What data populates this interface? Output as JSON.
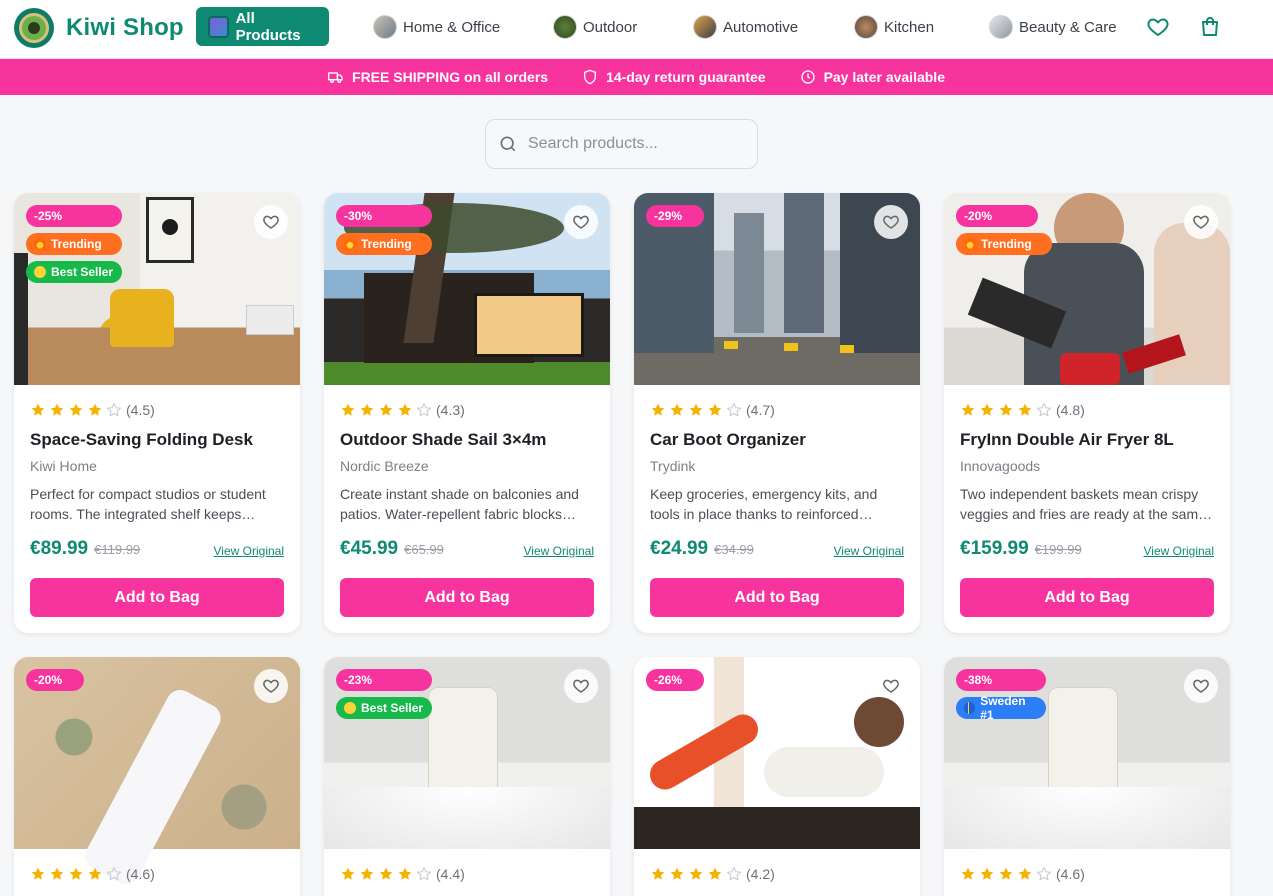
{
  "app": {
    "name": "Kiwi Shop"
  },
  "nav": {
    "all_products": "All Products",
    "categories": [
      "Home & Office",
      "Outdoor",
      "Automotive",
      "Kitchen",
      "Beauty & Care"
    ]
  },
  "promo": {
    "shipping": "FREE SHIPPING on all orders",
    "returns": "14-day return guarantee",
    "paylater": "Pay later available"
  },
  "search": {
    "placeholder": "Search products..."
  },
  "labels": {
    "add_to_bag": "Add to Bag",
    "view_original": "View Original"
  },
  "colors": {
    "accent": "#0f8a72",
    "pink": "#f7349d",
    "orange": "#ff6f1f",
    "green": "#16b94a",
    "blue": "#2b7ef3"
  },
  "products": [
    {
      "discount": "-25%",
      "badges": [
        "Trending",
        "Best Seller"
      ],
      "rating": 4.5,
      "rating_text": "(4.5)",
      "name": "Space-Saving Folding Desk",
      "brand": "Kiwi Home",
      "desc": "Perfect for compact studios or student rooms. The integrated shelf keeps essentials close.",
      "price": "€89.99",
      "old_price": "€119.99"
    },
    {
      "discount": "-30%",
      "badges": [
        "Trending"
      ],
      "rating": 4.3,
      "rating_text": "(4.3)",
      "name": "Outdoor Shade Sail 3×4m",
      "brand": "Nordic Breeze",
      "desc": "Create instant shade on balconies and patios. Water-repellent fabric blocks harsh sun.",
      "price": "€45.99",
      "old_price": "€65.99"
    },
    {
      "discount": "-29%",
      "badges": [],
      "rating": 4.7,
      "rating_text": "(4.7)",
      "name": "Car Boot Organizer",
      "brand": "Trydink",
      "desc": "Keep groceries, emergency kits, and tools in place thanks to reinforced dividers.",
      "price": "€24.99",
      "old_price": "€34.99"
    },
    {
      "discount": "-20%",
      "badges": [
        "Trending"
      ],
      "rating": 4.8,
      "rating_text": "(4.8)",
      "name": "FryInn Double Air Fryer 8L",
      "brand": "Innovagoods",
      "desc": "Two independent baskets mean crispy veggies and fries are ready at the same time.",
      "price": "€159.99",
      "old_price": "€199.99"
    },
    {
      "discount": "-20%",
      "badges": [],
      "rating": 4.6,
      "rating_text": "(4.6)"
    },
    {
      "discount": "-23%",
      "badges": [
        "Best Seller"
      ],
      "rating": 4.4,
      "rating_text": "(4.4)"
    },
    {
      "discount": "-26%",
      "badges": [],
      "rating": 4.2,
      "rating_text": "(4.2)"
    },
    {
      "discount": "-38%",
      "badges": [
        "Sweden #1"
      ],
      "rating": 4.6,
      "rating_text": "(4.6)"
    }
  ]
}
